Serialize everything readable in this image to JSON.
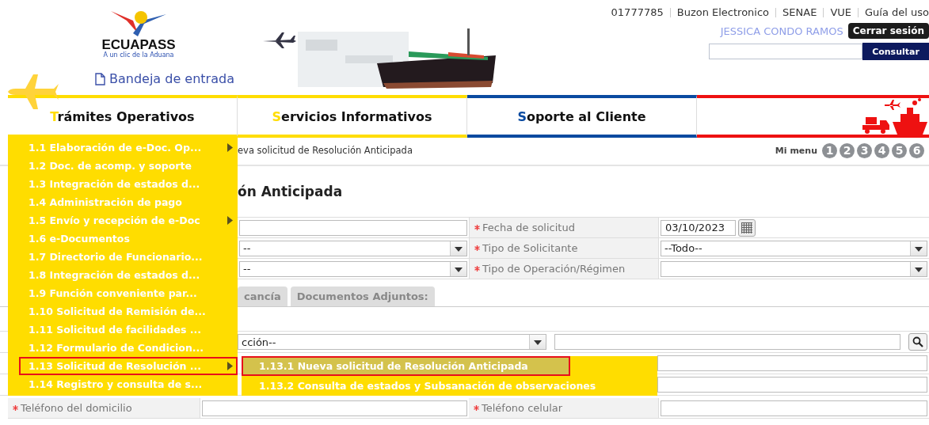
{
  "header": {
    "logo": {
      "name": "ECUAPASS",
      "tagline": "A un clic de la Aduana"
    },
    "inbox_link": "Bandeja de entrada",
    "top_links": [
      "01777785",
      "Buzon Electronico",
      "SENAE",
      "VUE",
      "Guía del uso"
    ],
    "user": "JESSICA CONDO RAMOS",
    "logout_button": "Cerrar sesión",
    "search_button": "Consultar"
  },
  "nav": [
    {
      "kind": "label",
      "label": "Trámites Operativos",
      "color": "#ffdd00"
    },
    {
      "kind": "label",
      "label": "Servicios Informativos",
      "color": "#ffdd00"
    },
    {
      "kind": "label",
      "label": "Soporte al Cliente",
      "color": "#0a4aa0"
    },
    {
      "kind": "icons",
      "color": "#ee1111"
    }
  ],
  "menu": {
    "items": [
      {
        "label": "1.1 Elaboración de e-Doc. Op...",
        "has_submenu": true,
        "selected": false
      },
      {
        "label": "1.2 Doc. de acomp. y soporte",
        "has_submenu": false,
        "selected": false
      },
      {
        "label": "1.3 Integración de estados d...",
        "has_submenu": false,
        "selected": false
      },
      {
        "label": "1.4 Administración de pago",
        "has_submenu": false,
        "selected": false
      },
      {
        "label": "1.5 Envío y recepción de e-Doc",
        "has_submenu": true,
        "selected": false
      },
      {
        "label": "1.6 e-Documentos",
        "has_submenu": false,
        "selected": false
      },
      {
        "label": "1.7 Directorio de Funcionario...",
        "has_submenu": false,
        "selected": false
      },
      {
        "label": "1.8 Integración de estados d...",
        "has_submenu": false,
        "selected": false
      },
      {
        "label": "1.9 Función conveniente par...",
        "has_submenu": false,
        "selected": false
      },
      {
        "label": "1.10 Solicitud de Remisión de...",
        "has_submenu": false,
        "selected": false
      },
      {
        "label": "1.11 Solicitud de facilidades ...",
        "has_submenu": false,
        "selected": false
      },
      {
        "label": "1.12 Formulario de Condicion...",
        "has_submenu": false,
        "selected": false
      },
      {
        "label": "1.13 Solicitud de Resolución ...",
        "has_submenu": true,
        "selected": true
      },
      {
        "label": "1.14 Registro y consulta de s...",
        "has_submenu": false,
        "selected": false
      }
    ],
    "submenu": [
      {
        "label": "1.13.1 Nueva solicitud de Resolución Anticipada",
        "selected": true
      },
      {
        "label": "1.13.2 Consulta de estados y Subsanación de observaciones",
        "selected": false
      }
    ]
  },
  "breadcrumb": "eva solicitud de Resolución Anticipada",
  "mi_menu": {
    "label": "Mi menu",
    "slots": [
      "1",
      "2",
      "3",
      "4",
      "5",
      "6"
    ]
  },
  "page_title": "ón Anticipada",
  "form_rows": [
    {
      "left": {
        "kind": "input"
      },
      "label": "Fecha de solicitud",
      "required": true,
      "kind": "date",
      "value": "03/10/2023"
    },
    {
      "left": {
        "kind": "select",
        "value": "--"
      },
      "label": "Tipo de Solicitante",
      "required": true,
      "kind": "select",
      "value": "--Todo--"
    },
    {
      "left": {
        "kind": "select",
        "value": "--"
      },
      "label": "Tipo de Operación/Régimen",
      "required": true,
      "kind": "select"
    }
  ],
  "tabs": [
    {
      "label": "cancía",
      "selected": false
    },
    {
      "label": "Documentos Adjuntos:",
      "selected": false
    }
  ],
  "search_row": {
    "select_value": "cción--"
  },
  "bottom_row": [
    {
      "label": "Teléfono del domicilio",
      "required": true
    },
    {
      "label": "Teléfono celular",
      "required": true
    }
  ]
}
